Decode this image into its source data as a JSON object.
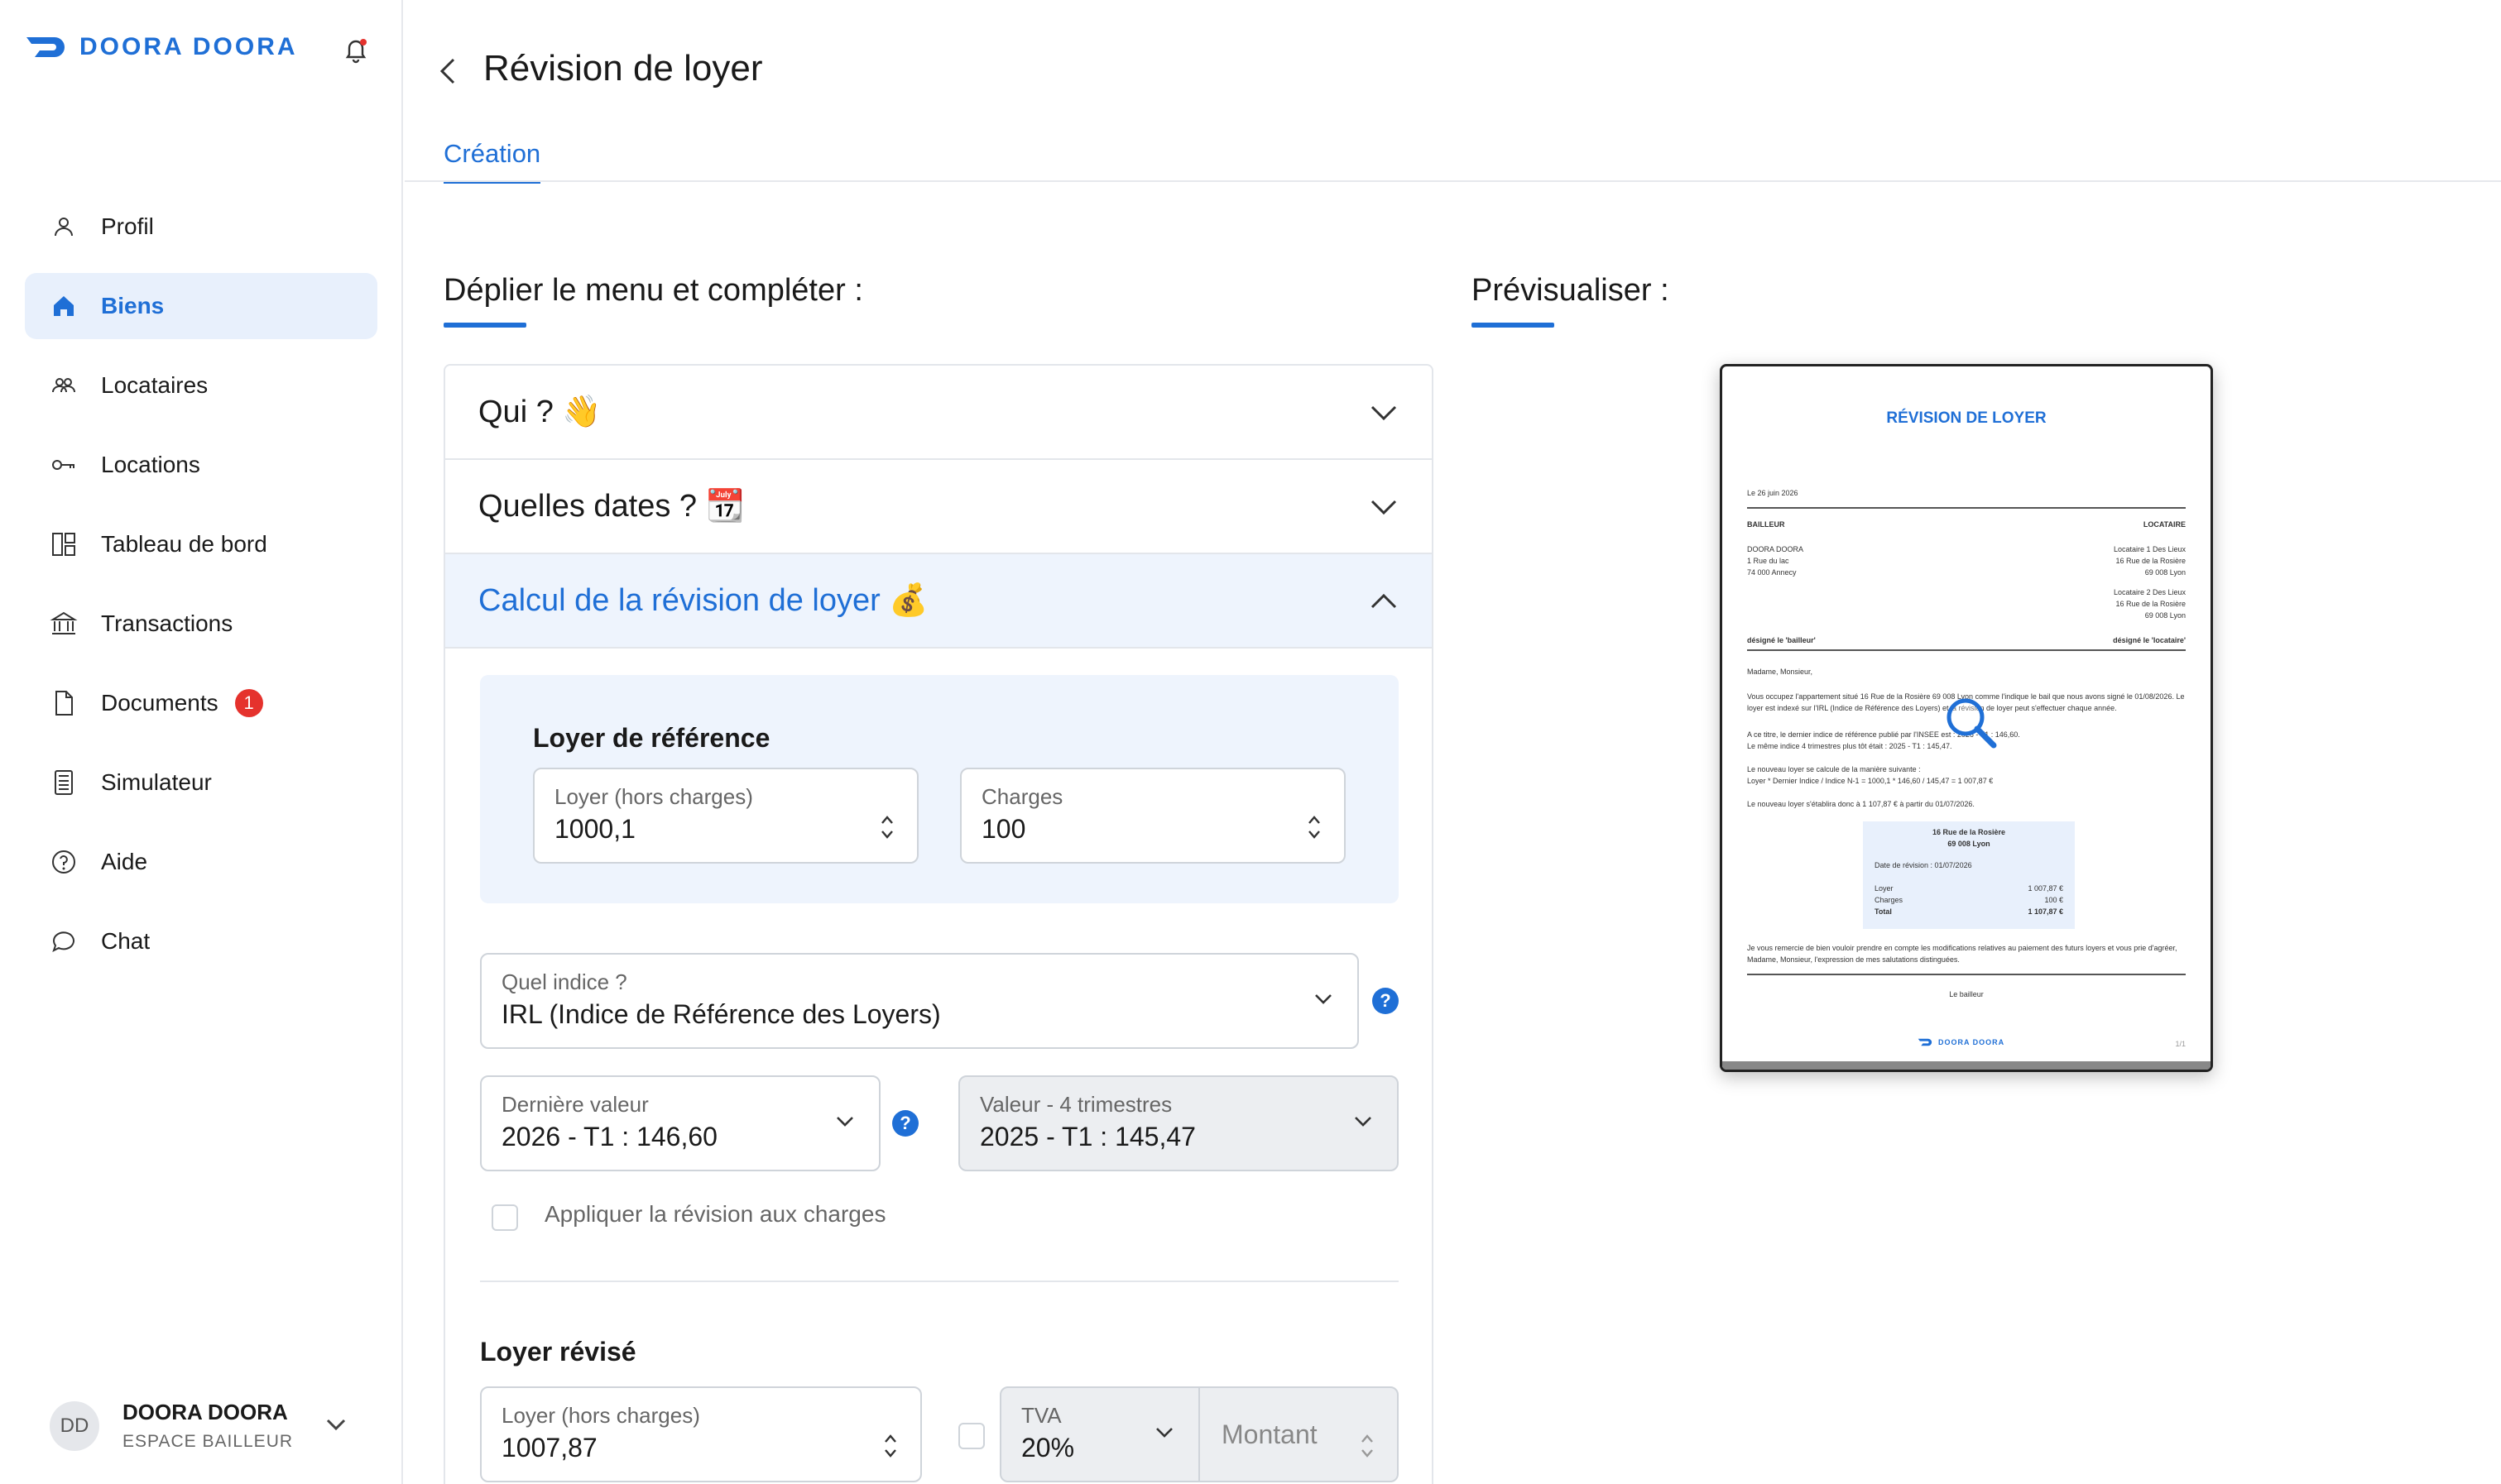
{
  "brand": {
    "name": "DOORA DOORA",
    "color": "#1f6fd6"
  },
  "sidebar": {
    "items": [
      {
        "label": "Profil",
        "icon": "user-icon"
      },
      {
        "label": "Biens",
        "icon": "home-icon",
        "active": true
      },
      {
        "label": "Locataires",
        "icon": "users-icon"
      },
      {
        "label": "Locations",
        "icon": "key-icon"
      },
      {
        "label": "Tableau de bord",
        "icon": "dashboard-icon"
      },
      {
        "label": "Transactions",
        "icon": "bank-icon"
      },
      {
        "label": "Documents",
        "icon": "document-icon",
        "badge": "1"
      },
      {
        "label": "Simulateur",
        "icon": "calculator-icon"
      },
      {
        "label": "Aide",
        "icon": "help-icon"
      },
      {
        "label": "Chat",
        "icon": "chat-icon"
      }
    ],
    "user": {
      "initials": "DD",
      "name": "DOORA DOORA",
      "role": "ESPACE BAILLEUR"
    }
  },
  "header": {
    "title": "Révision de loyer",
    "tab": "Création"
  },
  "form": {
    "heading": "Déplier le menu et compléter :",
    "sections": {
      "qui": "Qui ? 👋",
      "dates": "Quelles dates ? 📆",
      "calcul": "Calcul de la révision de loyer 💰"
    },
    "reference": {
      "title": "Loyer de référence",
      "loyer_label": "Loyer (hors charges)",
      "loyer_value": "1000,1",
      "charges_label": "Charges",
      "charges_value": "100"
    },
    "indice": {
      "label": "Quel indice ?",
      "value": "IRL (Indice de Référence des Loyers)"
    },
    "derniere": {
      "label": "Dernière valeur",
      "value": "2026 - T1 : 146,60"
    },
    "quatre": {
      "label": "Valeur - 4 trimestres",
      "value": "2025 - T1 : 145,47"
    },
    "appliquer_label": "Appliquer la révision aux charges",
    "revise": {
      "title": "Loyer révisé",
      "loyer_label": "Loyer (hors charges)",
      "loyer_value": "1007,87",
      "tva_label": "TVA",
      "tva_value": "20%",
      "montant_placeholder": "Montant"
    }
  },
  "preview": {
    "heading": "Prévisualiser :",
    "doc": {
      "title": "RÉVISION DE LOYER",
      "date": "Le 26 juin 2026",
      "bailleur_h": "BAILLEUR",
      "locataire_h": "LOCATAIRE",
      "bailleur_lines": [
        "DOORA DOORA",
        "1 Rue du lac",
        "74 000 Annecy"
      ],
      "loc1_lines": [
        "Locataire 1 Des Lieux",
        "16 Rue de la Rosière",
        "69 008 Lyon"
      ],
      "loc2_lines": [
        "Locataire 2 Des Lieux",
        "16 Rue de la Rosière",
        "69 008 Lyon"
      ],
      "designe_bailleur": "désigné le 'bailleur'",
      "designe_locataire": "désigné le 'locataire'",
      "salutation": "Madame, Monsieur,",
      "para1": "Vous occupez l'appartement situé 16 Rue de la Rosière 69 008 Lyon comme l'indique le bail que nous avons signé le 01/08/2026. Le loyer est indexé sur l'IRL (Indice de Référence des Loyers) et la révision de loyer peut s'effectuer chaque année.",
      "para2a": "A ce titre, le dernier indice de référence publié par l'INSEE est : 2026 - T1 : 146,60.",
      "para2b": "Le même indice 4 trimestres plus tôt était : 2025 - T1 : 145,47.",
      "para3a": "Le nouveau loyer se calcule de la manière suivante :",
      "para3b": "Loyer * Dernier Indice / Indice N-1 = 1000,1 * 146,60 / 145,47 = 1 007,87 €",
      "para4": "Le nouveau loyer s'établira donc à 1 107,87 € à partir du 01/07/2026.",
      "box_title1": "16 Rue de la Rosière",
      "box_title2": "69 008 Lyon",
      "box_date": "Date de révision : 01/07/2026",
      "rows": [
        {
          "k": "Loyer",
          "v": "1 007,87 €"
        },
        {
          "k": "Charges",
          "v": "100 €"
        },
        {
          "k": "Total",
          "v": "1 107,87 €"
        }
      ],
      "closing": "Je vous remercie de bien vouloir prendre en compte les modifications relatives au paiement des futurs loyers et vous prie d'agréer, Madame, Monsieur, l'expression de mes salutations distinguées.",
      "signature": "Le bailleur",
      "footer_brand": "DOORA DOORA",
      "page": "1/1"
    }
  }
}
